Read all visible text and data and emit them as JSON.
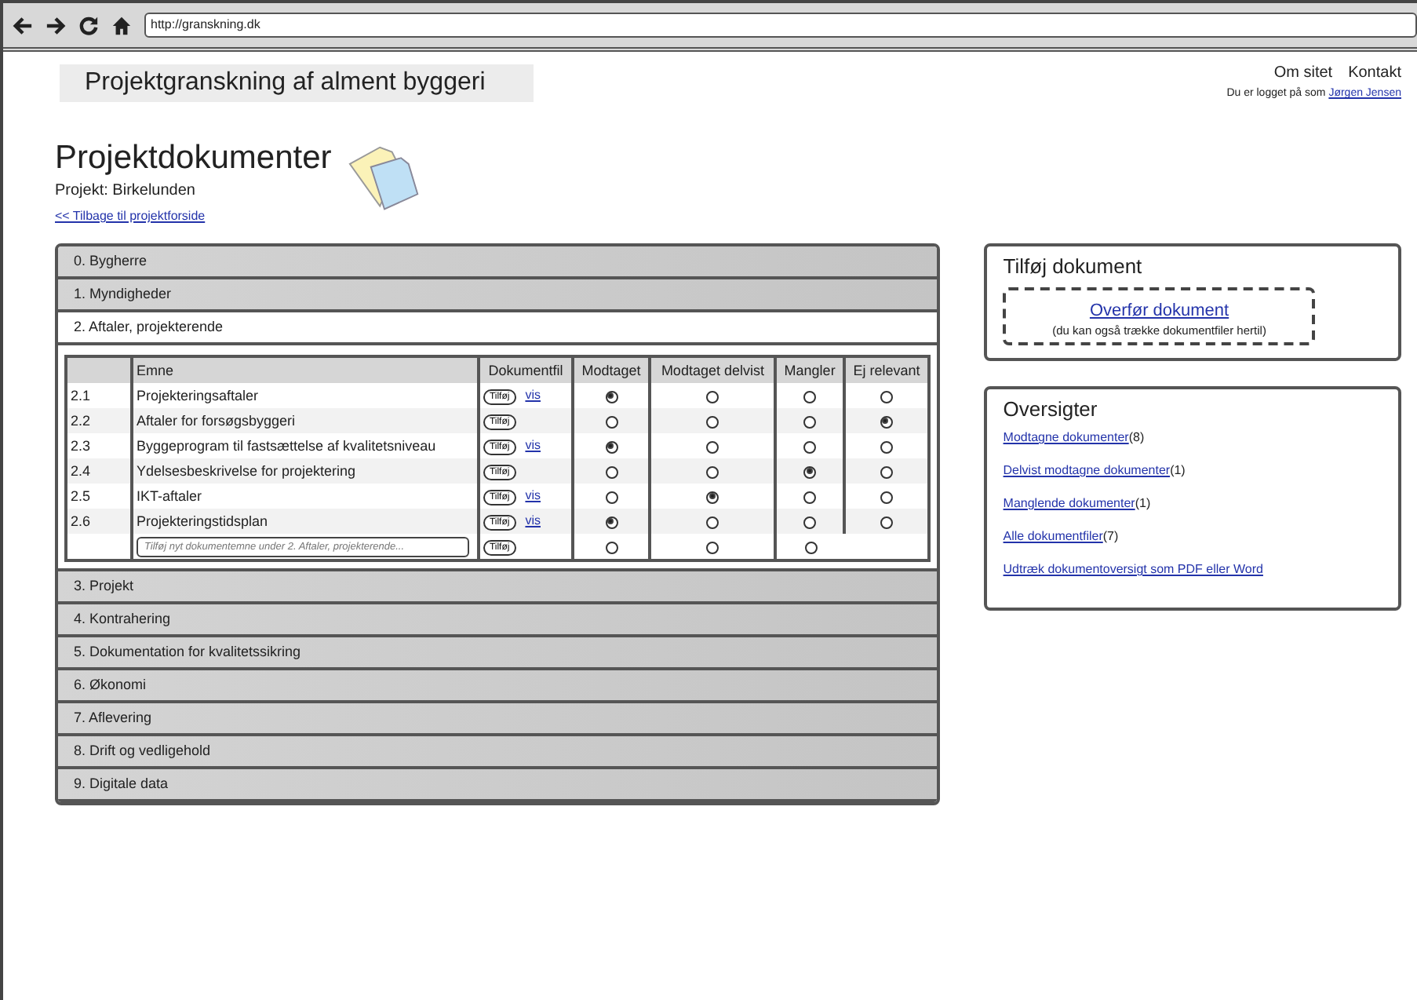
{
  "browser": {
    "url": "http://granskning.dk"
  },
  "header": {
    "site_title": "Projektgranskning af alment byggeri",
    "nav": [
      "Om sitet",
      "Kontakt"
    ],
    "login_text": "Du er logget på som",
    "user": "Jørgen Jensen"
  },
  "page": {
    "title": "Projektdokumenter",
    "project": "Projekt: Birkelunden",
    "back_link": "<< Tilbage til projektforside"
  },
  "sections": [
    {
      "label": "0. Bygherre",
      "expanded": false
    },
    {
      "label": "1. Myndigheder",
      "expanded": false
    },
    {
      "label": "2. Aftaler, projekterende",
      "expanded": true,
      "table": {
        "columns": [
          "Emne",
          "Dokumentfil",
          "Modtaget",
          "Modtaget delvist",
          "Mangler",
          "Ej relevant"
        ],
        "rows": [
          {
            "number": "2.1",
            "subject": "Projekteringsaftaler",
            "button": "Tilføj",
            "link": "vis",
            "statuses": [
              {
                "selected": true
              },
              {
                "selected": false
              },
              {
                "selected": false
              },
              {
                "selected": false
              }
            ]
          },
          {
            "number": "2.2",
            "subject": "Aftaler for forsøgsbyggeri",
            "button": "Tilføj",
            "statuses": [
              {
                "selected": false
              },
              {
                "selected": false
              },
              {
                "selected": false
              },
              {
                "selected": true
              }
            ]
          },
          {
            "number": "2.3",
            "subject": "Byggeprogram til fastsættelse af kvalitetsniveau",
            "button": "Tilføj",
            "link": "vis",
            "statuses": [
              {
                "selected": true
              },
              {
                "selected": false
              },
              {
                "selected": false
              },
              {
                "selected": false
              }
            ]
          },
          {
            "number": "2.4",
            "subject": "Ydelsesbeskrivelse for projektering",
            "button": "Tilføj",
            "statuses": [
              {
                "selected": false
              },
              {
                "selected": false
              },
              {
                "selected": true
              },
              {
                "selected": false
              }
            ]
          },
          {
            "number": "2.5",
            "subject": "IKT-aftaler",
            "button": "Tilføj",
            "link": "vis",
            "statuses": [
              {
                "selected": false
              },
              {
                "selected": true
              },
              {
                "selected": false
              },
              {
                "selected": false
              }
            ]
          },
          {
            "number": "2.6",
            "subject": "Projekteringstidsplan",
            "button": "Tilføj",
            "link": "vis",
            "statuses": [
              {
                "selected": true
              },
              {
                "selected": false
              },
              {
                "selected": false
              },
              {
                "selected": false
              }
            ]
          }
        ],
        "new_row": {
          "placeholder": "Tilføj nyt dokumentemne under 2. Aftaler, projekterende...",
          "button": "Tilføj",
          "statuses": [
            {
              "selected": false
            },
            {
              "selected": false
            },
            {
              "selected": false
            }
          ]
        }
      }
    },
    {
      "label": "3. Projekt",
      "expanded": false
    },
    {
      "label": "4. Kontrahering",
      "expanded": false
    },
    {
      "label": "5. Dokumentation for kvalitetssikring",
      "expanded": false
    },
    {
      "label": "6. Økonomi",
      "expanded": false
    },
    {
      "label": "7. Aflevering",
      "expanded": false
    },
    {
      "label": "8. Drift og vedligehold",
      "expanded": false
    },
    {
      "label": "9. Digitale data",
      "expanded": false
    }
  ],
  "add_document": {
    "title": "Tilføj dokument",
    "upload_link": "Overfør dokument",
    "hint": "(du kan også trække dokumentfiler hertil)"
  },
  "overviews": {
    "title": "Oversigter",
    "links": [
      {
        "label": "Modtagne dokumenter",
        "count": "(8)"
      },
      {
        "label": "Delvist modtagne dokumenter",
        "count": "(1)"
      },
      {
        "label": "Manglende dokumenter",
        "count": "(1)"
      },
      {
        "label": "Alle dokumentfiler",
        "count": "(7)"
      },
      {
        "label": "Udtræk dokumentoversigt som PDF eller Word"
      }
    ]
  }
}
